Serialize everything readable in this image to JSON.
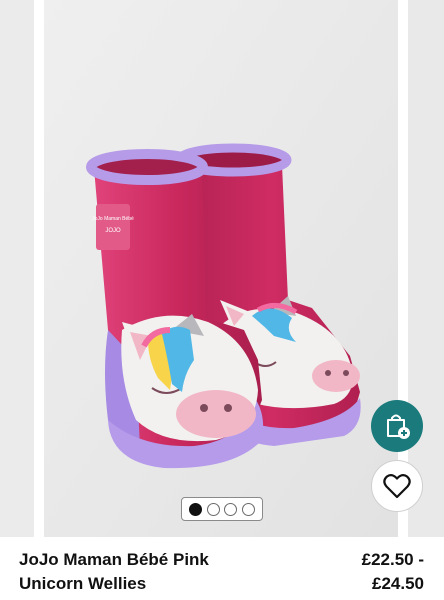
{
  "product": {
    "name_line1": "JoJo Maman Bébé Pink",
    "name_line2": "Unicorn Wellies",
    "price_line1": "£22.50 -",
    "price_line2": "£24.50"
  },
  "carousel": {
    "total_slides": 4,
    "active_index": 0
  },
  "boot_label": {
    "line1": "JoJo Maman Bébé",
    "line2": "JOJO"
  },
  "icons": {
    "quick_add": "shopping-bag-plus-icon",
    "wishlist": "heart-icon"
  },
  "colors": {
    "quick_add_bg": "#1a7a7c",
    "boot_pink": "#c72a5e",
    "boot_lilac": "#b59bea"
  }
}
